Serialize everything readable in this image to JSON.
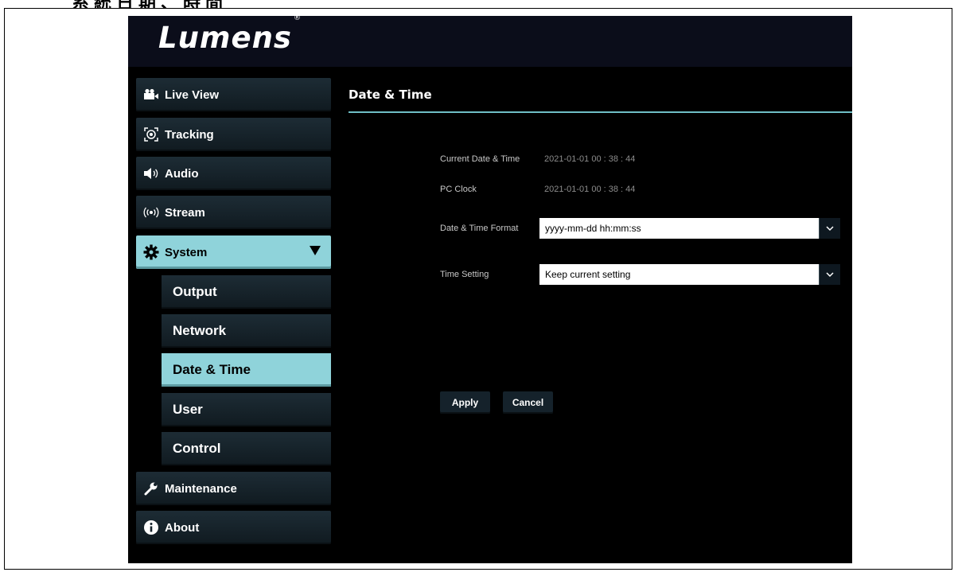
{
  "doc_heading": "系統日期、時間",
  "app": {
    "logo": "Lumens",
    "logo_mark": "®"
  },
  "sidebar": {
    "items": [
      {
        "label": "Live View",
        "icon": "video-camera-icon"
      },
      {
        "label": "Tracking",
        "icon": "tracking-target-icon"
      },
      {
        "label": "Audio",
        "icon": "speaker-icon"
      },
      {
        "label": "Stream",
        "icon": "broadcast-icon"
      },
      {
        "label": "System",
        "icon": "gear-icon",
        "expanded": true
      },
      {
        "label": "Maintenance",
        "icon": "wrench-icon"
      },
      {
        "label": "About",
        "icon": "info-icon"
      }
    ],
    "system_sub": [
      {
        "label": "Output"
      },
      {
        "label": "Network"
      },
      {
        "label": "Date & Time",
        "active": true
      },
      {
        "label": "User"
      },
      {
        "label": "Control"
      }
    ]
  },
  "main": {
    "title": "Date & Time",
    "current_label": "Current Date & Time",
    "current_value": "2021-01-01 00 : 38 : 44",
    "pc_label": "PC Clock",
    "pc_value": "2021-01-01 00 : 38 : 44",
    "format_label": "Date & Time Format",
    "format_value": "yyyy-mm-dd hh:mm:ss",
    "time_setting_label": "Time Setting",
    "time_setting_value": "Keep current setting",
    "apply_label": "Apply",
    "cancel_label": "Cancel"
  },
  "colors": {
    "accent": "#8fd3da",
    "title_line": "#6fbfc6",
    "panel_bg": "#000000"
  }
}
